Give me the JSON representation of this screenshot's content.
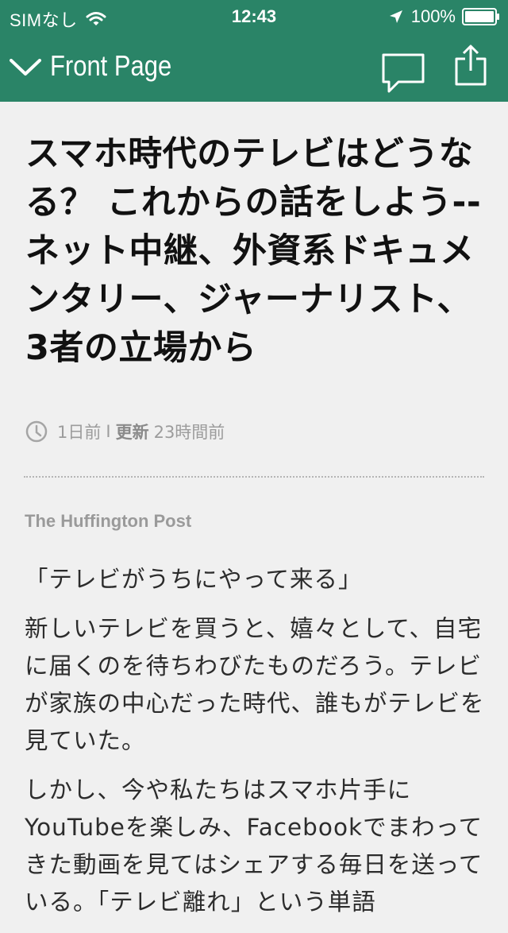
{
  "status_bar": {
    "carrier": "SIMなし",
    "time": "12:43",
    "battery": "100%"
  },
  "nav": {
    "title": "Front Page",
    "back_icon": "chevron-down-icon",
    "comment_icon": "comment-icon",
    "share_icon": "share-icon"
  },
  "article": {
    "headline": "スマホ時代のテレビはどうなる？ これからの話をしよう--ネット中継、外資系ドキュメンタリー、ジャーナリスト、3者の立場から",
    "meta": {
      "published": "1日前",
      "separator": "I",
      "updated_label": "更新",
      "updated": "23時間前"
    },
    "source": "The Huffington Post",
    "paragraphs": [
      "「テレビがうちにやって来る」",
      "新しいテレビを買うと、嬉々として、自宅に届くのを待ちわびたものだろう。テレビが家族の中心だった時代、誰もがテレビを見ていた。",
      "しかし、今や私たちはスマホ片手にYouTubeを楽しみ、Facebookでまわってきた動画を見てはシェアする毎日を送っている。「テレビ離れ」という単語"
    ]
  },
  "colors": {
    "header_bg": "#2a8467",
    "page_bg": "#f0f0f0",
    "headline": "#111111",
    "meta": "#9c9c9c",
    "body": "#2c2c2c"
  }
}
